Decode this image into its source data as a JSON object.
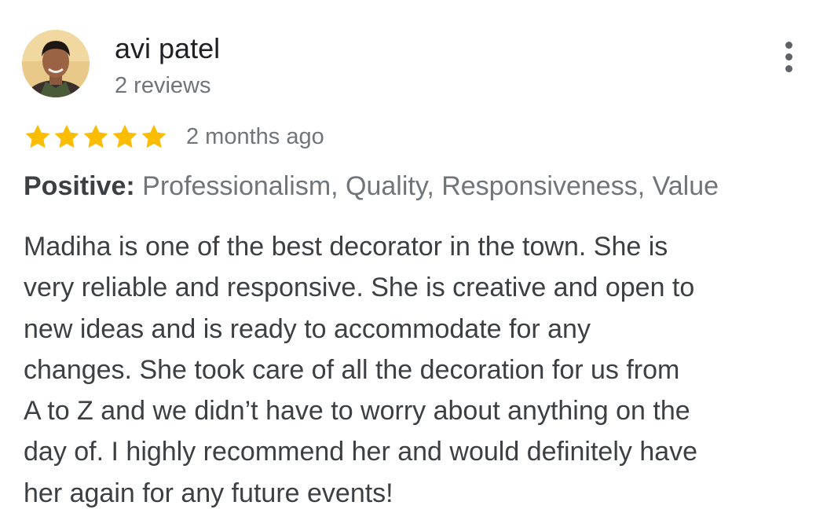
{
  "reviewer": {
    "name": "avi patel",
    "review_count": "2 reviews"
  },
  "more_options_icon": "vertical-ellipsis",
  "rating": {
    "stars": 5,
    "max_stars": 5,
    "star_color": "#fbbc04",
    "date": "2 months ago"
  },
  "positive": {
    "label": "Positive:",
    "values": " Professionalism, Quality, Responsiveness, Value"
  },
  "review_text": {
    "lines": [
      "Madiha is one of the best decorator in the town. She is",
      "very reliable and responsive. She is creative and open to",
      "new ideas and is ready to accommodate for any",
      "changes. She took care of all the decoration for us from",
      "A to Z and we didn’t have to worry about anything on the",
      "day of. I highly recommend her and would definitely have",
      "her again for any future events!"
    ]
  }
}
